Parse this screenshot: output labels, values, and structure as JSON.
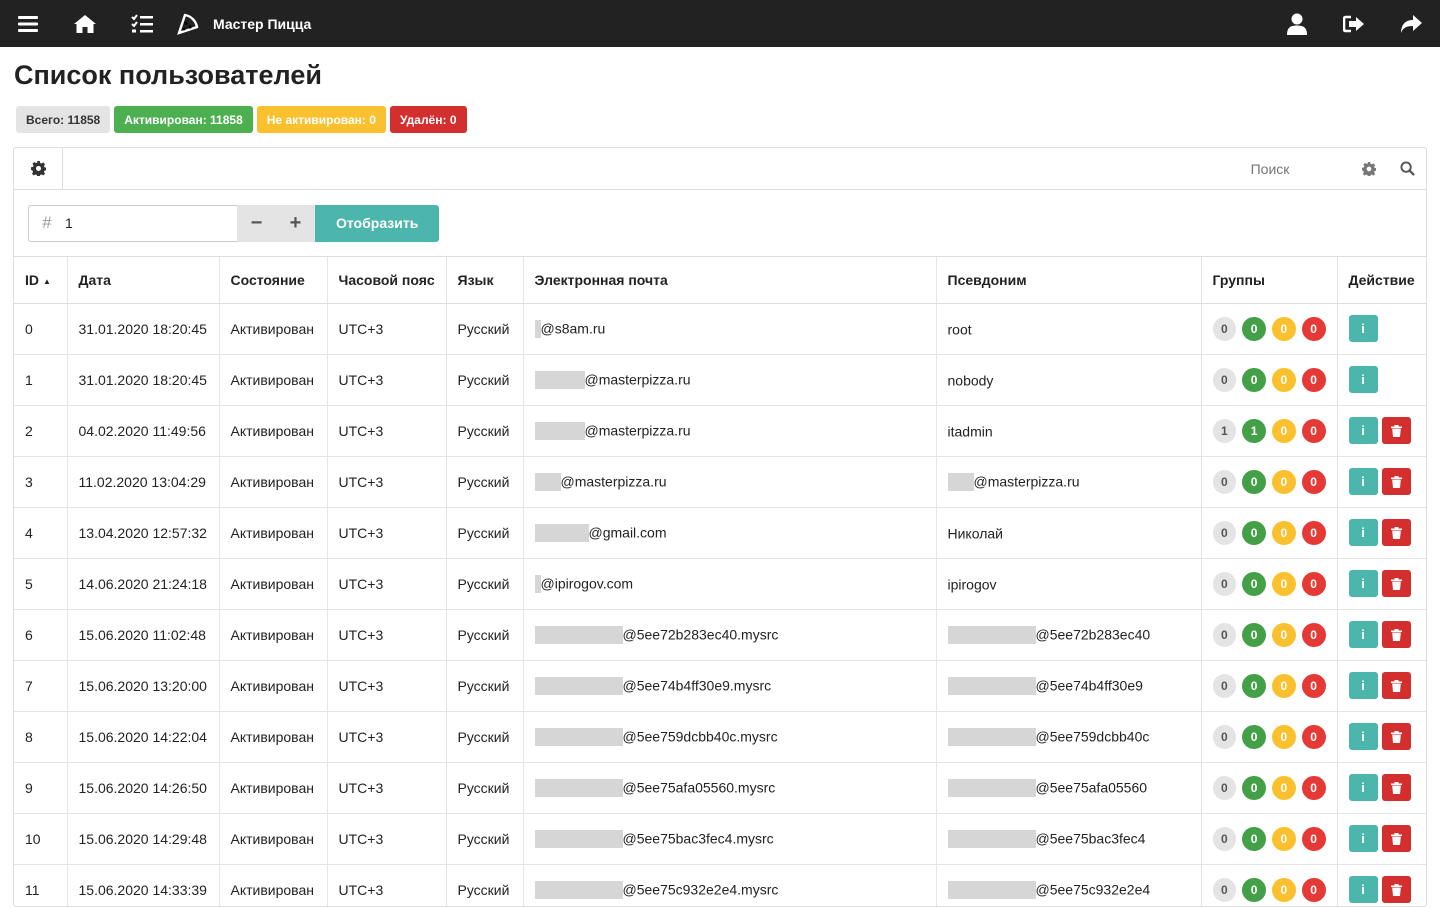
{
  "app": {
    "title": "Мастер Пицца"
  },
  "page": {
    "title": "Список пользователей"
  },
  "stats": [
    {
      "label": "Всего: 11858",
      "color": "#e4e4e4",
      "text_color": "#333"
    },
    {
      "label": "Активирован: 11858",
      "color": "#4caf50",
      "text_color": "#ffffff"
    },
    {
      "label": "Не активирован: 0",
      "color": "#fbc02d",
      "text_color": "#ffffff"
    },
    {
      "label": "Удалён: 0",
      "color": "#d32f2f",
      "text_color": "#ffffff"
    }
  ],
  "search": {
    "placeholder": "Поиск"
  },
  "controls": {
    "number_value": "1",
    "minus": "−",
    "plus": "+",
    "show_label": "Отобразить"
  },
  "table": {
    "columns": [
      "ID",
      "Дата",
      "Состояние",
      "Часовой пояс",
      "Язык",
      "Электронная почта",
      "Псевдоним",
      "Группы",
      "Действие"
    ],
    "rows": [
      {
        "id": "0",
        "date": "31.01.2020 18:20:45",
        "status": "Активирован",
        "tz": "UTC+3",
        "lang": "Русский",
        "email": "@s8am.ru",
        "email_redact": 6,
        "alias": "root",
        "alias_redact": 0,
        "groups": [
          "0",
          "0",
          "0",
          "0"
        ],
        "deletable": false
      },
      {
        "id": "1",
        "date": "31.01.2020 18:20:45",
        "status": "Активирован",
        "tz": "UTC+3",
        "lang": "Русский",
        "email": "@masterpizza.ru",
        "email_redact": 50,
        "alias": "nobody",
        "alias_redact": 0,
        "groups": [
          "0",
          "0",
          "0",
          "0"
        ],
        "deletable": false
      },
      {
        "id": "2",
        "date": "04.02.2020 11:49:56",
        "status": "Активирован",
        "tz": "UTC+3",
        "lang": "Русский",
        "email": "@masterpizza.ru",
        "email_redact": 50,
        "alias": "itadmin",
        "alias_redact": 0,
        "groups": [
          "1",
          "1",
          "0",
          "0"
        ],
        "deletable": true
      },
      {
        "id": "3",
        "date": "11.02.2020 13:04:29",
        "status": "Активирован",
        "tz": "UTC+3",
        "lang": "Русский",
        "email": "@masterpizza.ru",
        "email_redact": 26,
        "alias": "@masterpizza.ru",
        "alias_redact": 26,
        "groups": [
          "0",
          "0",
          "0",
          "0"
        ],
        "deletable": true
      },
      {
        "id": "4",
        "date": "13.04.2020 12:57:32",
        "status": "Активирован",
        "tz": "UTC+3",
        "lang": "Русский",
        "email": "@gmail.com",
        "email_redact": 54,
        "alias": "Николай",
        "alias_redact": 0,
        "groups": [
          "0",
          "0",
          "0",
          "0"
        ],
        "deletable": true
      },
      {
        "id": "5",
        "date": "14.06.2020 21:24:18",
        "status": "Активирован",
        "tz": "UTC+3",
        "lang": "Русский",
        "email": "@ipirogov.com",
        "email_redact": 6,
        "alias": "ipirogov",
        "alias_redact": 0,
        "groups": [
          "0",
          "0",
          "0",
          "0"
        ],
        "deletable": true
      },
      {
        "id": "6",
        "date": "15.06.2020 11:02:48",
        "status": "Активирован",
        "tz": "UTC+3",
        "lang": "Русский",
        "email": "@5ee72b283ec40.mysrc",
        "email_redact": 88,
        "alias": "@5ee72b283ec40",
        "alias_redact": 88,
        "groups": [
          "0",
          "0",
          "0",
          "0"
        ],
        "deletable": true
      },
      {
        "id": "7",
        "date": "15.06.2020 13:20:00",
        "status": "Активирован",
        "tz": "UTC+3",
        "lang": "Русский",
        "email": "@5ee74b4ff30e9.mysrc",
        "email_redact": 88,
        "alias": "@5ee74b4ff30e9",
        "alias_redact": 88,
        "groups": [
          "0",
          "0",
          "0",
          "0"
        ],
        "deletable": true
      },
      {
        "id": "8",
        "date": "15.06.2020 14:22:04",
        "status": "Активирован",
        "tz": "UTC+3",
        "lang": "Русский",
        "email": "@5ee759dcbb40c.mysrc",
        "email_redact": 88,
        "alias": "@5ee759dcbb40c",
        "alias_redact": 88,
        "groups": [
          "0",
          "0",
          "0",
          "0"
        ],
        "deletable": true
      },
      {
        "id": "9",
        "date": "15.06.2020 14:26:50",
        "status": "Активирован",
        "tz": "UTC+3",
        "lang": "Русский",
        "email": "@5ee75afa05560.mysrc",
        "email_redact": 88,
        "alias": "@5ee75afa05560",
        "alias_redact": 88,
        "groups": [
          "0",
          "0",
          "0",
          "0"
        ],
        "deletable": true
      },
      {
        "id": "10",
        "date": "15.06.2020 14:29:48",
        "status": "Активирован",
        "tz": "UTC+3",
        "lang": "Русский",
        "email": "@5ee75bac3fec4.mysrc",
        "email_redact": 88,
        "alias": "@5ee75bac3fec4",
        "alias_redact": 88,
        "groups": [
          "0",
          "0",
          "0",
          "0"
        ],
        "deletable": true
      },
      {
        "id": "11",
        "date": "15.06.2020 14:33:39",
        "status": "Активирован",
        "tz": "UTC+3",
        "lang": "Русский",
        "email": "@5ee75c932e2e4.mysrc",
        "email_redact": 88,
        "alias": "@5ee75c932e2e4",
        "alias_redact": 88,
        "groups": [
          "0",
          "0",
          "0",
          "0"
        ],
        "deletable": true
      }
    ],
    "group_colors": [
      "gray",
      "green",
      "yellow",
      "red"
    ]
  },
  "icons": {
    "topbar_left": [
      "menu-icon",
      "home-icon",
      "tasks-icon",
      "pizza-icon"
    ],
    "topbar_right": [
      "user-icon",
      "sign-out-icon",
      "share-icon"
    ]
  }
}
